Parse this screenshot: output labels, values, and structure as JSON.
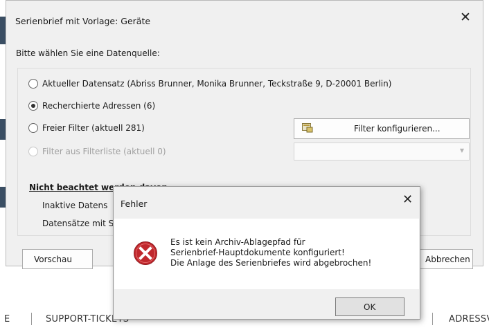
{
  "dialog": {
    "title": "Serienbrief mit Vorlage: Geräte",
    "close_glyph": "✕",
    "prompt": "Bitte wählen Sie eine Datenquelle:",
    "options": [
      {
        "label": "Aktueller Datensatz (Abriss Brunner, Monika Brunner, Teckstraße 9, D-20001 Berlin)",
        "selected": false,
        "disabled": false
      },
      {
        "label": "Recherchierte Adressen (6)",
        "selected": true,
        "disabled": false
      },
      {
        "label": "Freier Filter (aktuell 281)",
        "selected": false,
        "disabled": false
      },
      {
        "label": "Filter aus Filterliste (aktuell 0)",
        "selected": false,
        "disabled": true
      }
    ],
    "filter_button_label": "Filter konfigurieren...",
    "filter_list_value": "",
    "section_heading": "Nicht beachtet werden davon",
    "section_lines": [
      "Inaktive Datens",
      "Datensätze mit S"
    ],
    "preview_button": "Vorschau",
    "cancel_button": "Abbrechen"
  },
  "error": {
    "title": "Fehler",
    "close_glyph": "✕",
    "message_lines": [
      "Es ist kein Archiv-Ablagepfad für",
      "Serienbrief-Hauptdokumente konfiguriert!",
      "Die Anlage des Serienbriefes wird abgebrochen!"
    ],
    "ok_button": "OK"
  },
  "taskbar": {
    "items": [
      "E",
      "SUPPORT-TICKETS",
      "ADRESSV"
    ]
  },
  "colors": {
    "error_icon": "#c0282d",
    "dialog_bg": "#f0f0f0",
    "left_stripe": "#3a4e63"
  }
}
